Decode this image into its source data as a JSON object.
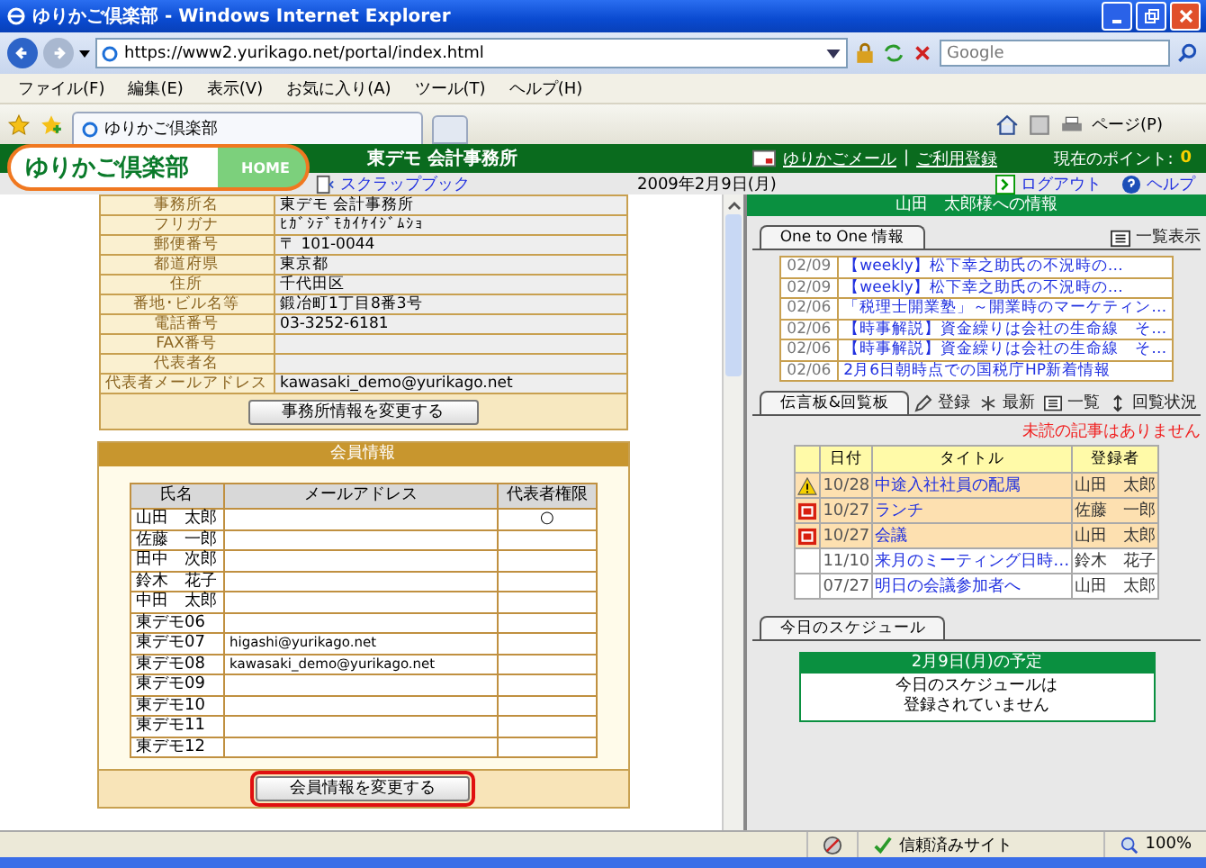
{
  "browser": {
    "title": "ゆりかご倶楽部 - Windows Internet Explorer",
    "url": "https://www2.yurikago.net/portal/index.html",
    "search_placeholder": "Google",
    "menu": [
      "ファイル(F)",
      "編集(E)",
      "表示(V)",
      "お気に入り(A)",
      "ツール(T)",
      "ヘルプ(H)"
    ],
    "tab": "ゆりかご倶楽部",
    "page_menu": "ページ(P)"
  },
  "header": {
    "logo": "ゆりかご倶楽部",
    "home": "HOME",
    "title": "東デモ 会計事務所",
    "links": [
      "ゆりかごメール",
      "ご利用登録"
    ],
    "separator": "|",
    "points_label": "現在のポイント:",
    "points": "0"
  },
  "subbar": {
    "scrapbook": "スクラップブック",
    "date": "2009年2月9日(月)",
    "logout": "ログアウト",
    "help": "ヘルプ"
  },
  "office": {
    "rows": [
      {
        "label": "事務所名",
        "value": "東デモ 会計事務所"
      },
      {
        "label": "フリガナ",
        "value": "ﾋｶﾞｼﾃﾞﾓｶｲｹｲｼﾞﾑｼｮ"
      },
      {
        "label": "郵便番号",
        "value": "〒 101-0044"
      },
      {
        "label": "都道府県",
        "value": "東京都"
      },
      {
        "label": "住所",
        "value": "千代田区"
      },
      {
        "label": "番地･ビル名等",
        "value": "鍛冶町1丁目8番3号"
      },
      {
        "label": "電話番号",
        "value": "03-3252-6181"
      },
      {
        "label": "FAX番号"
      },
      {
        "label": "代表者名"
      },
      {
        "label": "代表者メールアドレス",
        "value": "kawasaki_demo@yurikago.net"
      }
    ],
    "button": "事務所情報を変更する"
  },
  "members": {
    "title": "会員情報",
    "columns": [
      "氏名",
      "メールアドレス",
      "代表者権限"
    ],
    "rows": [
      {
        "name": "山田　太郎",
        "rep": "○"
      },
      {
        "name": "佐藤　一郎"
      },
      {
        "name": "田中　次郎"
      },
      {
        "name": "鈴木　花子"
      },
      {
        "name": "中田　太郎"
      },
      {
        "name": "東デモ06"
      },
      {
        "name": "東デモ07",
        "email": "higashi@yurikago.net"
      },
      {
        "name": "東デモ08",
        "email": "kawasaki_demo@yurikago.net"
      },
      {
        "name": "東デモ09"
      },
      {
        "name": "東デモ10"
      },
      {
        "name": "東デモ11"
      },
      {
        "name": "東デモ12"
      }
    ],
    "button": "会員情報を変更する",
    "button_highlighted": true
  },
  "right": {
    "heading": "山田　太郎様への情報",
    "one_to_one": {
      "tab": "One to One 情報",
      "link": "一覧表示",
      "items": [
        {
          "date": "02/09",
          "title": "【weekly】松下幸之助氏の不況時の…"
        },
        {
          "date": "02/09",
          "title": "【weekly】松下幸之助氏の不況時の…"
        },
        {
          "date": "02/06",
          "title": "「税理士開業塾」～開業時のマーケティン…"
        },
        {
          "date": "02/06",
          "title": "【時事解説】資金繰りは会社の生命線　そ…"
        },
        {
          "date": "02/06",
          "title": "【時事解説】資金繰りは会社の生命線　そ…"
        },
        {
          "date": "02/06",
          "title": "2月6日朝時点での国税庁HP新着情報"
        }
      ]
    },
    "board": {
      "tab": "伝言板&回覧板",
      "actions": [
        {
          "kind": "pencil",
          "label": "登録"
        },
        {
          "kind": "asterisk",
          "label": "最新"
        },
        {
          "kind": "list",
          "label": "一覧"
        },
        {
          "kind": "arrows",
          "label": "回覧状況"
        }
      ],
      "notice": "未読の記事はありません",
      "columns": [
        "日付",
        "タイトル",
        "登録者"
      ],
      "rows": [
        {
          "kind": "warning",
          "date": "10/28",
          "title": "中途入社社員の配属",
          "author": "山田　太郎"
        },
        {
          "kind": "new",
          "date": "10/27",
          "title": "ランチ",
          "author": "佐藤　一郎"
        },
        {
          "kind": "new",
          "date": "10/27",
          "title": "会議",
          "author": "山田　太郎"
        },
        {
          "kind": "plain",
          "date": "11/10",
          "title": "来月のミーティング日時…",
          "author": "鈴木　花子"
        },
        {
          "kind": "plain",
          "date": "07/27",
          "title": "明日の会議参加者へ",
          "author": "山田　太郎"
        }
      ]
    },
    "schedule": {
      "tab": "今日のスケジュール",
      "heading": "2月9日(月)の予定",
      "message": [
        "今日のスケジュールは",
        "登録されていません"
      ]
    }
  },
  "status": {
    "zone": "信頼済みサイト",
    "zoom": "100%"
  }
}
